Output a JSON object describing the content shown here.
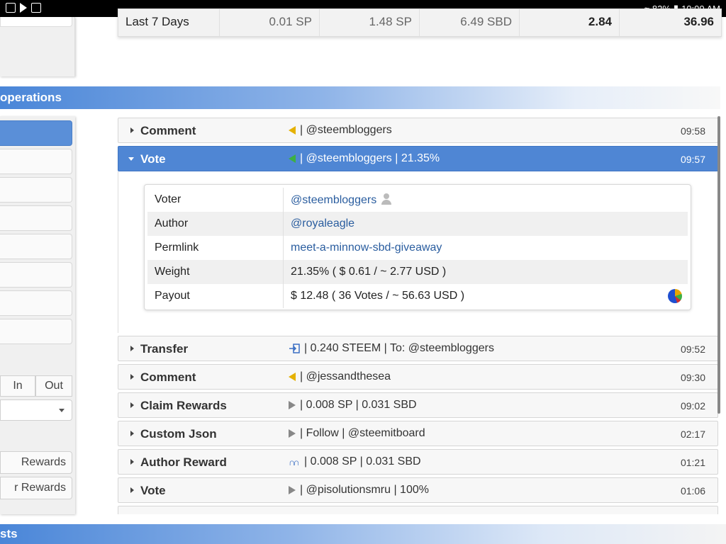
{
  "status_bar": {
    "battery": "82%",
    "time": "10:00 AM"
  },
  "summary": {
    "label": "Last 7 Days",
    "values": [
      "0.01 SP",
      "1.48 SP",
      "6.49 SBD",
      "2.84",
      "36.96"
    ]
  },
  "sections": {
    "operations": "operations",
    "bottom": "sts"
  },
  "sidebar": {
    "in_label": "In",
    "out_label": "Out",
    "rewards_1": "Rewards",
    "rewards_2": "r Rewards"
  },
  "operations": [
    {
      "name": "Comment",
      "icon": "comment-icon",
      "detail": "| @steembloggers",
      "time": "09:58"
    },
    {
      "name": "Vote",
      "icon": "upvote-icon",
      "detail": "| @steembloggers | 21.35%",
      "time": "09:57"
    },
    {
      "name": "Transfer",
      "icon": "transfer-icon",
      "detail": "| 0.240 STEEM | To: @steembloggers",
      "time": "09:52"
    },
    {
      "name": "Comment",
      "icon": "comment-icon",
      "detail": "| @jessandthesea",
      "time": "09:30"
    },
    {
      "name": "Claim Rewards",
      "icon": "play-icon",
      "detail": "| 0.008 SP | 0.031 SBD",
      "time": "09:02"
    },
    {
      "name": "Custom Json",
      "icon": "play-icon",
      "detail": "| Follow | @steemitboard",
      "time": "02:17"
    },
    {
      "name": "Author Reward",
      "icon": "steem-icon",
      "detail": "| 0.008 SP | 0.031 SBD",
      "time": "01:21"
    },
    {
      "name": "Vote",
      "icon": "play-icon",
      "detail": "| @pisolutionsmru | 100%",
      "time": "01:06"
    }
  ],
  "vote_detail": {
    "voter_label": "Voter",
    "voter": "@steembloggers",
    "author_label": "Author",
    "author": "@royaleagle",
    "permlink_label": "Permlink",
    "permlink": "meet-a-minnow-sbd-giveaway",
    "weight_label": "Weight",
    "weight": "21.35% ( $ 0.61 / ~ 2.77 USD )",
    "payout_label": "Payout",
    "payout": "$ 12.48 ( 36 Votes / ~ 56.63 USD )"
  },
  "colors": {
    "accent": "#4f86d4",
    "link": "#2a5d9f",
    "comment_icon": "#e5b100",
    "vote_icon": "#3cb043"
  }
}
